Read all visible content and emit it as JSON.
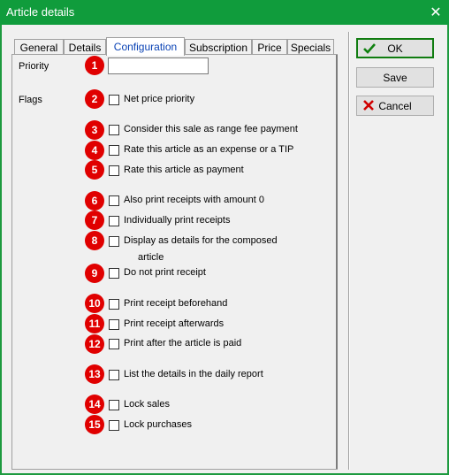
{
  "window": {
    "title": "Article details",
    "close": "✕"
  },
  "tabs": [
    {
      "label": "General"
    },
    {
      "label": "Details"
    },
    {
      "label": "Configuration"
    },
    {
      "label": "Subscription"
    },
    {
      "label": "Price"
    },
    {
      "label": "Specials"
    }
  ],
  "active_tab": "Configuration",
  "priority": {
    "label": "Priority",
    "value": ""
  },
  "flags_label": "Flags",
  "options": [
    {
      "n": "1",
      "text": ""
    },
    {
      "n": "2",
      "text": "Net price priority",
      "checked": false
    },
    {
      "n": "3",
      "text": "Consider this sale as range fee payment",
      "checked": false
    },
    {
      "n": "4",
      "text": "Rate this article as an expense or a TIP",
      "checked": false
    },
    {
      "n": "5",
      "text": "Rate this article as payment",
      "checked": false
    },
    {
      "n": "6",
      "text": "Also print receipts with amount 0",
      "checked": false
    },
    {
      "n": "7",
      "text": "Individually print receipts",
      "checked": false
    },
    {
      "n": "8",
      "text": "Display as details for the composed",
      "text2": "article",
      "checked": false
    },
    {
      "n": "9",
      "text": "Do not print receipt",
      "checked": false
    },
    {
      "n": "10",
      "text": "Print receipt beforehand",
      "checked": false
    },
    {
      "n": "11",
      "text": "Print receipt afterwards",
      "checked": false
    },
    {
      "n": "12",
      "text": "Print after the article is paid",
      "checked": false
    },
    {
      "n": "13",
      "text": "List the details in the daily report",
      "checked": false
    },
    {
      "n": "14",
      "text": "Lock sales",
      "checked": false
    },
    {
      "n": "15",
      "text": "Lock purchases",
      "checked": false
    }
  ],
  "buttons": {
    "ok": {
      "label": "OK",
      "icon": "check-icon"
    },
    "save": {
      "label": "Save"
    },
    "cancel": {
      "label": "Cancel",
      "icon": "cancel-x-icon"
    }
  },
  "colors": {
    "titlebar": "#109c3c",
    "badge": "#e00000",
    "active_tab_text": "#0b43b5"
  }
}
